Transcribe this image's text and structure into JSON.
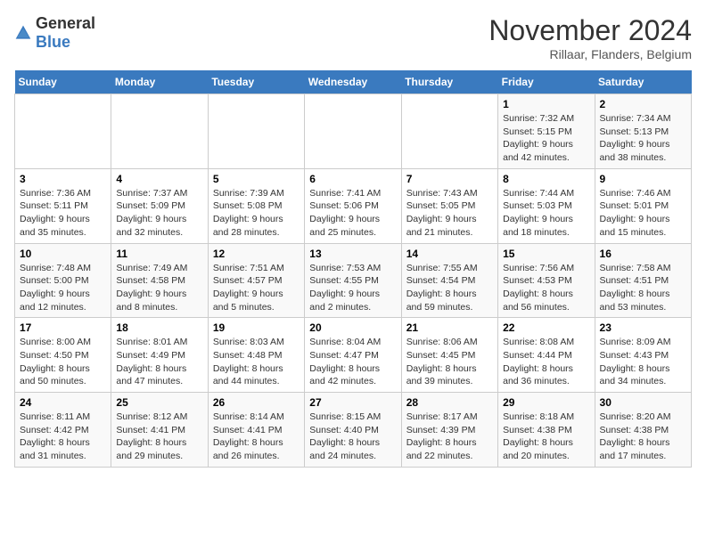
{
  "header": {
    "logo_general": "General",
    "logo_blue": "Blue",
    "title": "November 2024",
    "location": "Rillaar, Flanders, Belgium"
  },
  "days_of_week": [
    "Sunday",
    "Monday",
    "Tuesday",
    "Wednesday",
    "Thursday",
    "Friday",
    "Saturday"
  ],
  "weeks": [
    [
      {
        "day": "",
        "info": ""
      },
      {
        "day": "",
        "info": ""
      },
      {
        "day": "",
        "info": ""
      },
      {
        "day": "",
        "info": ""
      },
      {
        "day": "",
        "info": ""
      },
      {
        "day": "1",
        "info": "Sunrise: 7:32 AM\nSunset: 5:15 PM\nDaylight: 9 hours and 42 minutes."
      },
      {
        "day": "2",
        "info": "Sunrise: 7:34 AM\nSunset: 5:13 PM\nDaylight: 9 hours and 38 minutes."
      }
    ],
    [
      {
        "day": "3",
        "info": "Sunrise: 7:36 AM\nSunset: 5:11 PM\nDaylight: 9 hours and 35 minutes."
      },
      {
        "day": "4",
        "info": "Sunrise: 7:37 AM\nSunset: 5:09 PM\nDaylight: 9 hours and 32 minutes."
      },
      {
        "day": "5",
        "info": "Sunrise: 7:39 AM\nSunset: 5:08 PM\nDaylight: 9 hours and 28 minutes."
      },
      {
        "day": "6",
        "info": "Sunrise: 7:41 AM\nSunset: 5:06 PM\nDaylight: 9 hours and 25 minutes."
      },
      {
        "day": "7",
        "info": "Sunrise: 7:43 AM\nSunset: 5:05 PM\nDaylight: 9 hours and 21 minutes."
      },
      {
        "day": "8",
        "info": "Sunrise: 7:44 AM\nSunset: 5:03 PM\nDaylight: 9 hours and 18 minutes."
      },
      {
        "day": "9",
        "info": "Sunrise: 7:46 AM\nSunset: 5:01 PM\nDaylight: 9 hours and 15 minutes."
      }
    ],
    [
      {
        "day": "10",
        "info": "Sunrise: 7:48 AM\nSunset: 5:00 PM\nDaylight: 9 hours and 12 minutes."
      },
      {
        "day": "11",
        "info": "Sunrise: 7:49 AM\nSunset: 4:58 PM\nDaylight: 9 hours and 8 minutes."
      },
      {
        "day": "12",
        "info": "Sunrise: 7:51 AM\nSunset: 4:57 PM\nDaylight: 9 hours and 5 minutes."
      },
      {
        "day": "13",
        "info": "Sunrise: 7:53 AM\nSunset: 4:55 PM\nDaylight: 9 hours and 2 minutes."
      },
      {
        "day": "14",
        "info": "Sunrise: 7:55 AM\nSunset: 4:54 PM\nDaylight: 8 hours and 59 minutes."
      },
      {
        "day": "15",
        "info": "Sunrise: 7:56 AM\nSunset: 4:53 PM\nDaylight: 8 hours and 56 minutes."
      },
      {
        "day": "16",
        "info": "Sunrise: 7:58 AM\nSunset: 4:51 PM\nDaylight: 8 hours and 53 minutes."
      }
    ],
    [
      {
        "day": "17",
        "info": "Sunrise: 8:00 AM\nSunset: 4:50 PM\nDaylight: 8 hours and 50 minutes."
      },
      {
        "day": "18",
        "info": "Sunrise: 8:01 AM\nSunset: 4:49 PM\nDaylight: 8 hours and 47 minutes."
      },
      {
        "day": "19",
        "info": "Sunrise: 8:03 AM\nSunset: 4:48 PM\nDaylight: 8 hours and 44 minutes."
      },
      {
        "day": "20",
        "info": "Sunrise: 8:04 AM\nSunset: 4:47 PM\nDaylight: 8 hours and 42 minutes."
      },
      {
        "day": "21",
        "info": "Sunrise: 8:06 AM\nSunset: 4:45 PM\nDaylight: 8 hours and 39 minutes."
      },
      {
        "day": "22",
        "info": "Sunrise: 8:08 AM\nSunset: 4:44 PM\nDaylight: 8 hours and 36 minutes."
      },
      {
        "day": "23",
        "info": "Sunrise: 8:09 AM\nSunset: 4:43 PM\nDaylight: 8 hours and 34 minutes."
      }
    ],
    [
      {
        "day": "24",
        "info": "Sunrise: 8:11 AM\nSunset: 4:42 PM\nDaylight: 8 hours and 31 minutes."
      },
      {
        "day": "25",
        "info": "Sunrise: 8:12 AM\nSunset: 4:41 PM\nDaylight: 8 hours and 29 minutes."
      },
      {
        "day": "26",
        "info": "Sunrise: 8:14 AM\nSunset: 4:41 PM\nDaylight: 8 hours and 26 minutes."
      },
      {
        "day": "27",
        "info": "Sunrise: 8:15 AM\nSunset: 4:40 PM\nDaylight: 8 hours and 24 minutes."
      },
      {
        "day": "28",
        "info": "Sunrise: 8:17 AM\nSunset: 4:39 PM\nDaylight: 8 hours and 22 minutes."
      },
      {
        "day": "29",
        "info": "Sunrise: 8:18 AM\nSunset: 4:38 PM\nDaylight: 8 hours and 20 minutes."
      },
      {
        "day": "30",
        "info": "Sunrise: 8:20 AM\nSunset: 4:38 PM\nDaylight: 8 hours and 17 minutes."
      }
    ]
  ]
}
